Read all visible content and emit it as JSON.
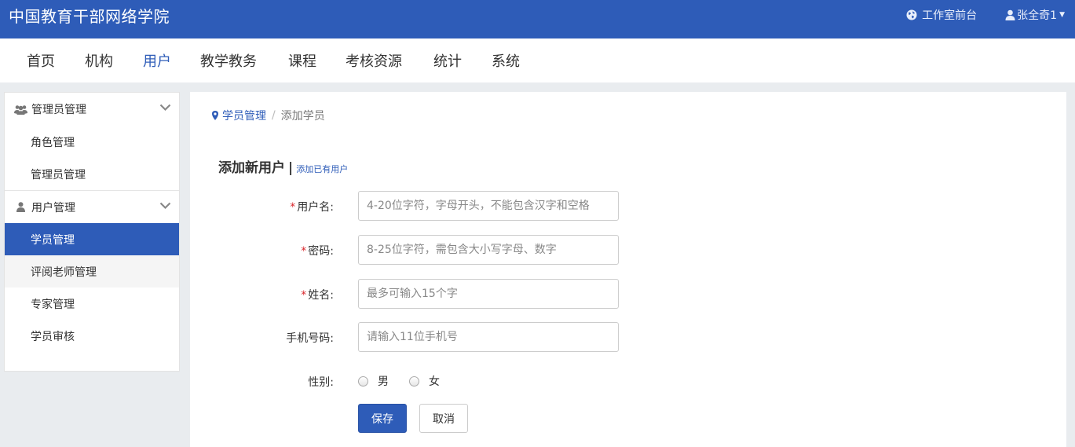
{
  "header": {
    "brand": "中国教育干部网络学院",
    "studio_link": "工作室前台",
    "user_name": "张全奇1"
  },
  "nav": {
    "items": [
      "首页",
      "机构",
      "用户",
      "教学教务",
      "课程",
      "考核资源",
      "统计",
      "系统"
    ],
    "active": "用户"
  },
  "sidebar": {
    "groups": [
      {
        "label": "管理员管理",
        "icon": "users-icon",
        "items": [
          "角色管理",
          "管理员管理"
        ]
      },
      {
        "label": "用户管理",
        "icon": "user-icon",
        "items": [
          "学员管理",
          "评阅老师管理",
          "专家管理",
          "学员审核"
        ]
      }
    ],
    "active_item": "学员管理",
    "hovered_item": "评阅老师管理"
  },
  "breadcrumb": {
    "parent": "学员管理",
    "separator": "/",
    "current": "添加学员"
  },
  "form": {
    "title": "添加新用户",
    "divider": "|",
    "alt_link": "添加已有用户",
    "required_mark": "*",
    "fields": {
      "username": {
        "label": "用户名:",
        "placeholder": "4-20位字符，字母开头，不能包含汉字和空格",
        "value": ""
      },
      "password": {
        "label": "密码:",
        "placeholder": "8-25位字符，需包含大小写字母、数字",
        "value": ""
      },
      "name": {
        "label": "姓名:",
        "placeholder": "最多可输入15个字",
        "value": ""
      },
      "phone": {
        "label": "手机号码:",
        "placeholder": "请输入11位手机号",
        "value": ""
      }
    },
    "gender": {
      "label": "性别:",
      "options": [
        "男",
        "女"
      ],
      "selected": null
    },
    "save_label": "保存",
    "cancel_label": "取消"
  },
  "colors": {
    "primary": "#2e5cb8",
    "required": "#d9262c",
    "page_bg": "#e9ecef"
  }
}
